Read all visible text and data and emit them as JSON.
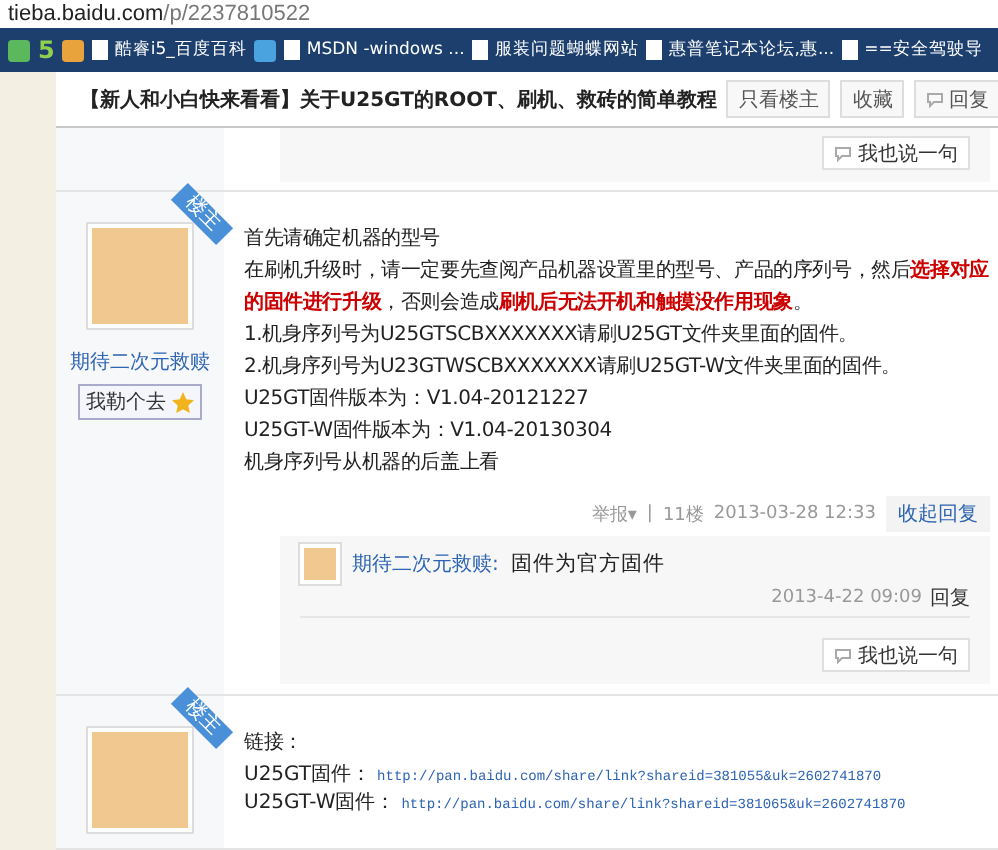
{
  "browser": {
    "url_host": "tieba.baidu.com",
    "url_path": "/p/2237810522",
    "bookmarks": [
      {
        "kind": "icon"
      },
      {
        "kind": "glyph",
        "label": "5"
      },
      {
        "kind": "icon"
      },
      {
        "kind": "page",
        "label": "酷睿i5_百度百科"
      },
      {
        "kind": "icon"
      },
      {
        "kind": "page",
        "label": "MSDN -windows ..."
      },
      {
        "kind": "page",
        "label": "服装问题蝴蝶网站"
      },
      {
        "kind": "page",
        "label": "惠普笔记本论坛,惠..."
      },
      {
        "kind": "page",
        "label": "==安全驾驶导"
      }
    ]
  },
  "thread": {
    "title": "【新人和小白快来看看】关于U25GT的ROOT、刷机、救砖的简单教程",
    "buttons": [
      {
        "label": "只看楼主",
        "kind": "plain"
      },
      {
        "label": "收藏",
        "kind": "plain"
      },
      {
        "label": "回复",
        "kind": "reply"
      }
    ]
  },
  "previous_post": {
    "reply_button": "我也说一句"
  },
  "posts": [
    {
      "author": "期待二次元救赎",
      "badge": "我勒个去",
      "ribbon": "楼主",
      "lines": [
        {
          "kind": "text",
          "text": "首先请确定机器的型号"
        },
        {
          "kind": "text",
          "text": "在刷机升级时，请一定要先查阅产品机器设置里的型号、产品的序列号，然后**选择对应的固件进行升级**，否则会造成**刷机后无法开机和触摸没作用现象**。"
        },
        {
          "kind": "text",
          "text": "1.机身序列号为U25GTSCBXXXXXXX请刷U25GT文件夹里面的固件。"
        },
        {
          "kind": "text",
          "text": "2.机身序列号为U23GTWSCBXXXXXXX请刷U25GT-W文件夹里面的固件。"
        },
        {
          "kind": "text",
          "text": "U25GT固件版本为：V1.04-20121227"
        },
        {
          "kind": "text",
          "text": "U25GT-W固件版本为：V1.04-20130304"
        },
        {
          "kind": "text",
          "text": "机身序列号从机器的后盖上看"
        }
      ],
      "footer": {
        "report": "举报▾",
        "separator": "|",
        "floor": "11楼",
        "time": "2013-03-28 12:33",
        "toggle": "收起回复"
      },
      "replies": [
        {
          "author": "期待二次元救赎:",
          "text": "固件为官方固件",
          "time": "2013-4-22 09:09",
          "action": "回复"
        }
      ],
      "reply_button": "我也说一句"
    },
    {
      "ribbon": "楼主",
      "lines": [
        {
          "kind": "text",
          "text": "链接："
        },
        {
          "kind": "link",
          "text": "U25GT固件：",
          "url": "http://pan.baidu.com/share/link?shareid=381055&uk=2602741870"
        },
        {
          "kind": "link",
          "text": "U25GT-W固件：",
          "url": "http://pan.baidu.com/share/link?shareid=381065&uk=2602741870"
        }
      ]
    }
  ]
}
